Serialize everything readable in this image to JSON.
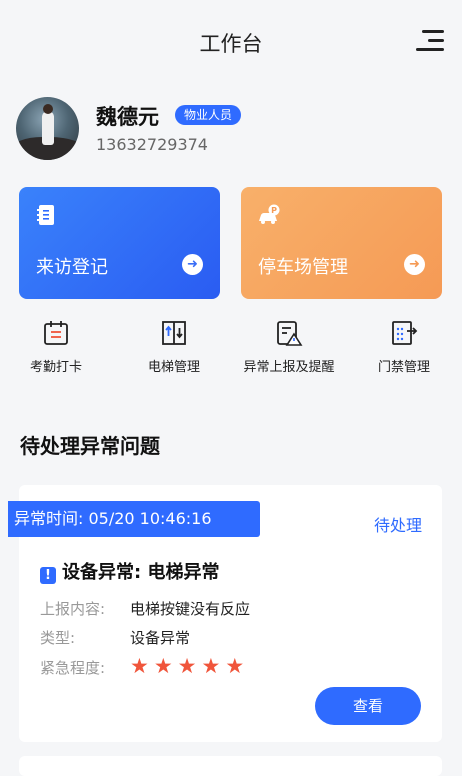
{
  "header": {
    "title": "工作台",
    "menu_icon": "menu-icon"
  },
  "profile": {
    "name": "魏德元",
    "role": "物业人员",
    "phone": "13632729374"
  },
  "cards": [
    {
      "label": "来访登记",
      "icon": "visitor-register-icon",
      "color": "#2f6bff"
    },
    {
      "label": "停车场管理",
      "icon": "parking-icon",
      "color": "#f59a55"
    }
  ],
  "quick_actions": [
    {
      "label": "考勤打卡",
      "icon": "calendar-check-icon"
    },
    {
      "label": "电梯管理",
      "icon": "elevator-icon"
    },
    {
      "label": "异常上报及提醒",
      "icon": "report-alert-icon"
    },
    {
      "label": "门禁管理",
      "icon": "access-control-icon"
    }
  ],
  "section_title": "待处理异常问题",
  "issue": {
    "time": "异常时间: 05/20 10:46:16",
    "status": "待处理",
    "title": "设备异常: 电梯异常",
    "fields": [
      {
        "key": "上报内容:",
        "value": "电梯按键没有反应"
      },
      {
        "key": "类型:",
        "value": "设备异常"
      },
      {
        "key": "紧急程度:",
        "value": ""
      }
    ],
    "urgency_stars": 5,
    "button": "查看"
  },
  "colors": {
    "primary": "#2f6bff",
    "orange": "#f59a55",
    "star": "#f0553b"
  }
}
